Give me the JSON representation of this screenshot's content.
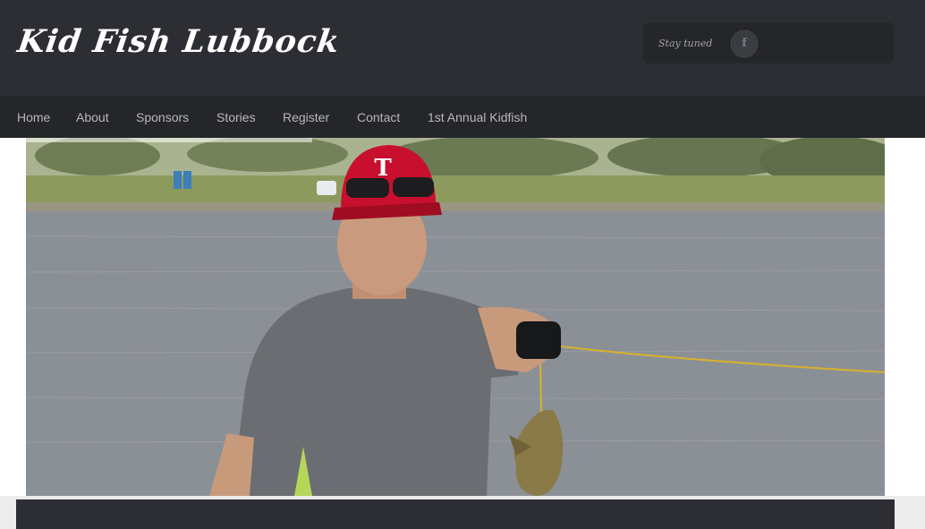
{
  "site": {
    "title": "Kid Fish Lubbock"
  },
  "header": {
    "stay_tuned_label": "Stay tuned",
    "facebook_icon_glyph": "f"
  },
  "nav": {
    "items": [
      {
        "label": "Home"
      },
      {
        "label": "About"
      },
      {
        "label": "Sponsors"
      },
      {
        "label": "Stories"
      },
      {
        "label": "Register"
      },
      {
        "label": "Contact"
      },
      {
        "label": "1st Annual Kidfish"
      }
    ]
  },
  "colors": {
    "header_bg": "#2c2e33",
    "nav_bg": "#24262a",
    "nav_text": "#b8b8b8",
    "cap_red": "#c8102e"
  },
  "hero": {
    "icon": "photo-boy-holding-fish"
  }
}
